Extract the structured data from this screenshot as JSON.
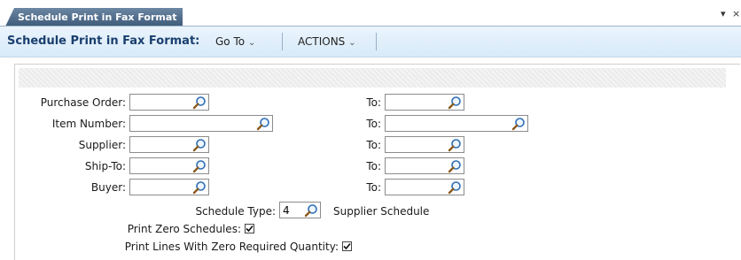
{
  "tab": {
    "label": "Schedule Print in Fax Format"
  },
  "window": {
    "menu_glyph": "▾",
    "close_glyph": "×"
  },
  "header": {
    "title": "Schedule Print in Fax Format:",
    "goto_label": "Go To",
    "actions_label": "ACTIONS",
    "dropdown_glyph": "⌄"
  },
  "form": {
    "purchase_order": {
      "label": "Purchase Order:",
      "value": "",
      "to_label": "To:",
      "to_value": ""
    },
    "item_number": {
      "label": "Item Number:",
      "value": "",
      "to_label": "To:",
      "to_value": ""
    },
    "supplier": {
      "label": "Supplier:",
      "value": "",
      "to_label": "To:",
      "to_value": ""
    },
    "ship_to": {
      "label": "Ship-To:",
      "value": "",
      "to_label": "To:",
      "to_value": ""
    },
    "buyer": {
      "label": "Buyer:",
      "value": "",
      "to_label": "To:",
      "to_value": ""
    },
    "schedule_type": {
      "label": "Schedule Type:",
      "value": "4",
      "description": "Supplier Schedule"
    },
    "print_zero_schedules": {
      "label": "Print Zero Schedules:",
      "checked": true
    },
    "print_zero_required": {
      "label": "Print Lines With Zero Required Quantity:",
      "checked": true
    }
  },
  "icons": {
    "lookup": "magnifier-icon",
    "checkbox_checked": "checkmark-icon"
  }
}
